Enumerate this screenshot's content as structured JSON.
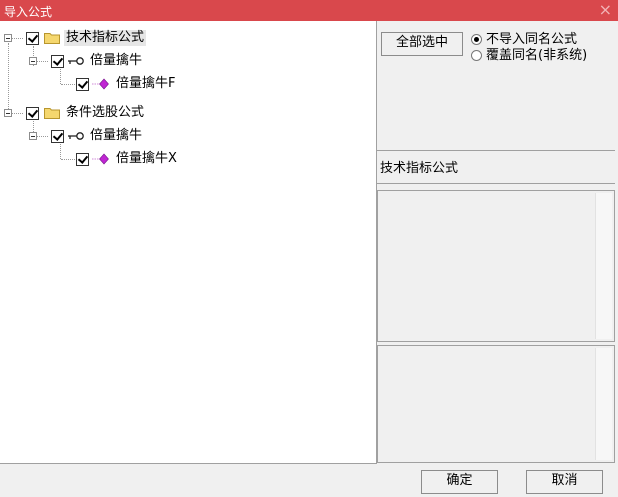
{
  "window": {
    "title": "导入公式",
    "close_glyph": "×"
  },
  "tree": {
    "nodes": [
      {
        "label": "技术指标公式",
        "type": "folder",
        "checked": true
      },
      {
        "label": "倍量擒牛",
        "type": "key",
        "checked": true
      },
      {
        "label": "倍量擒牛F",
        "type": "formula",
        "checked": true
      },
      {
        "label": "条件选股公式",
        "type": "folder",
        "checked": true
      },
      {
        "label": "倍量擒牛",
        "type": "key",
        "checked": true
      },
      {
        "label": "倍量擒牛X",
        "type": "formula",
        "checked": true
      }
    ]
  },
  "right": {
    "select_all_label": "全部选中",
    "options": [
      {
        "label": "不导入同名公式",
        "selected": true
      },
      {
        "label": "覆盖同名(非系统)",
        "selected": false
      }
    ],
    "category_label": "技术指标公式"
  },
  "footer": {
    "ok_label": "确定",
    "cancel_label": "取消"
  },
  "colors": {
    "title_bar": "#d9484c",
    "folder": "#f5d76e",
    "gem": "#c026d3"
  }
}
